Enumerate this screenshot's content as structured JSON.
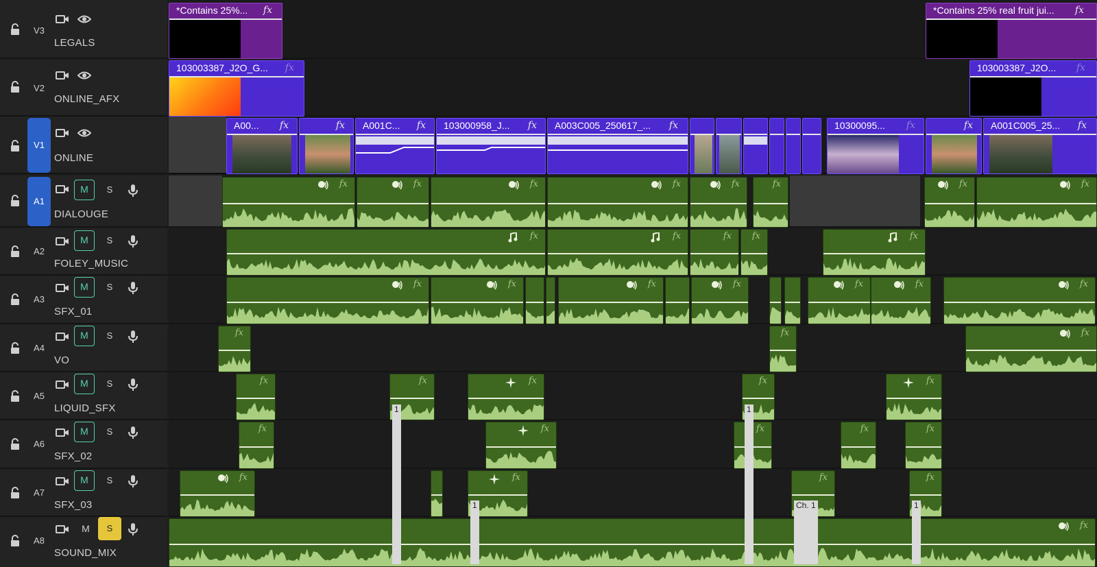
{
  "video_tracks": [
    {
      "id": "V3",
      "name": "LEGALS",
      "active": false
    },
    {
      "id": "V2",
      "name": "ONLINE_AFX",
      "active": false
    },
    {
      "id": "V1",
      "name": "ONLINE",
      "active": true
    }
  ],
  "audio_tracks": [
    {
      "id": "A1",
      "name": "DIALOUGE",
      "active": true,
      "m": "M",
      "s": "S",
      "m_on": true,
      "s_on": false
    },
    {
      "id": "A2",
      "name": "FOLEY_MUSIC",
      "active": false,
      "m": "M",
      "s": "S",
      "m_on": true,
      "s_on": false
    },
    {
      "id": "A3",
      "name": "SFX_01",
      "active": false,
      "m": "M",
      "s": "S",
      "m_on": true,
      "s_on": false
    },
    {
      "id": "A4",
      "name": "VO",
      "active": false,
      "m": "M",
      "s": "S",
      "m_on": true,
      "s_on": false
    },
    {
      "id": "A5",
      "name": "LIQUID_SFX",
      "active": false,
      "m": "M",
      "s": "S",
      "m_on": true,
      "s_on": false
    },
    {
      "id": "A6",
      "name": "SFX_02",
      "active": false,
      "m": "M",
      "s": "S",
      "m_on": true,
      "s_on": false
    },
    {
      "id": "A7",
      "name": "SFX_03",
      "active": false,
      "m": "M",
      "s": "S",
      "m_on": true,
      "s_on": false
    },
    {
      "id": "A8",
      "name": "SOUND_MIX",
      "active": false,
      "m": "M",
      "s": "S",
      "m_on": false,
      "s_on": true
    }
  ],
  "clips": {
    "legal_1": "*Contains 25%...",
    "legal_2": "*Contains 25% real fruit jui...",
    "afx_1": "103003387_J2O_G...",
    "afx_2": "103003387_J2O...",
    "v1_a": "A00...",
    "v1_c": "A001C...",
    "v1_d": "103000958_J...",
    "v1_e": "A003C005_250617_...",
    "v1_f": "10300095...",
    "v1_h": "A001C005_25..."
  },
  "markers": {
    "one": "1",
    "ch1": "Ch. 1"
  },
  "fx_label": "fx",
  "colors": {
    "video_clip": "#4d2acf",
    "legal_clip": "#6b2090",
    "audio_clip": "#3e6720",
    "track_active": "#2c62c8",
    "mute_accent": "#56d1b0",
    "solo_on": "#e5c53a"
  }
}
